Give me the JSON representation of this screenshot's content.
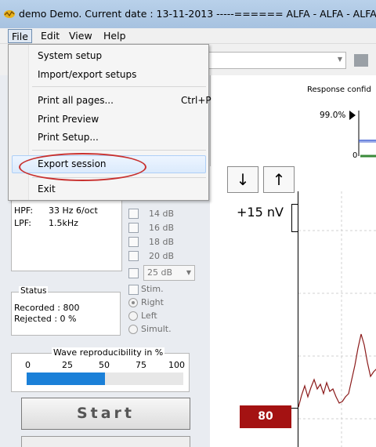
{
  "window": {
    "title": "demo Demo. Current date : 13-11-2013    -----====== ALFA - ALFA - ALFA"
  },
  "menubar": {
    "items": [
      "File",
      "Edit",
      "View",
      "Help"
    ]
  },
  "file_menu": {
    "items": [
      {
        "label": "System setup",
        "shortcut": ""
      },
      {
        "label": "Import/export setups",
        "shortcut": ""
      },
      {
        "label": "Print all pages...",
        "shortcut": "Ctrl+P"
      },
      {
        "label": "Print Preview",
        "shortcut": ""
      },
      {
        "label": "Print Setup...",
        "shortcut": ""
      },
      {
        "label": "Export session",
        "shortcut": ""
      },
      {
        "label": "Exit",
        "shortcut": ""
      }
    ],
    "highlighted": "Export session"
  },
  "filter_panel": {
    "hpf_label": "HPF:",
    "hpf_value": "33 Hz 6/oct",
    "lpf_label": "LPF:",
    "lpf_value": "1.5kHz"
  },
  "levels": {
    "options": [
      "14 dB",
      "16 dB",
      "18 dB",
      "20 dB"
    ],
    "selected_db": "25 dB",
    "stim_label": "Stim.",
    "ears": [
      "Right",
      "Left",
      "Simult."
    ],
    "selected_ear": "Right"
  },
  "status": {
    "title": "Status",
    "recorded": "Recorded :  800",
    "rejected": "Rejected :   0 %"
  },
  "reproducibility": {
    "label": "Wave reproducibility in %",
    "ticks": [
      "0",
      "25",
      "50",
      "75",
      "100"
    ],
    "value_percent": 50
  },
  "buttons": {
    "start": "Start"
  },
  "response": {
    "title": "Response confid",
    "value": "99.0%",
    "zero": "0"
  },
  "waveform": {
    "scale_label": "+15 nV",
    "level_box": "80",
    "down_arrow": "↓",
    "up_arrow": "↑"
  },
  "colors": {
    "accent_bar": "#1b80d8",
    "level_box": "#a41212",
    "annotation_ellipse": "#c8312f",
    "wave": "#8b1a1a"
  }
}
